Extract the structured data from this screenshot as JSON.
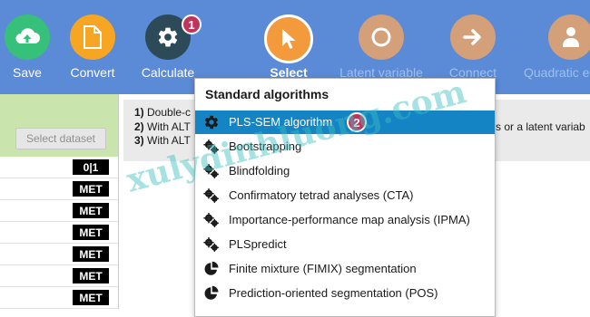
{
  "toolbar": {
    "save": "Save",
    "convert": "Convert",
    "calculate": "Calculate",
    "select": "Select",
    "latent": "Latent variable",
    "connect": "Connect",
    "quadratic": "Quadratic e",
    "badge1": "1"
  },
  "left": {
    "select_dataset": "Select dataset",
    "rows": [
      "0|1",
      "MET",
      "MET",
      "MET",
      "MET",
      "MET",
      "MET",
      ""
    ]
  },
  "info": {
    "line1_num": "1)",
    "line1": "Double-c",
    "line1_right": "",
    "line2_num": "2)",
    "line2": "With ALT",
    "line2_right": "s or a latent variab",
    "line3_num": "3)",
    "line3": "With ALT",
    "line3_right": "."
  },
  "menu": {
    "title": "Standard algorithms",
    "badge2": "2",
    "items": [
      {
        "label": "PLS-SEM algorithm",
        "icon": "gear-icon"
      },
      {
        "label": "Bootstrapping",
        "icon": "gears-icon"
      },
      {
        "label": "Blindfolding",
        "icon": "gears-icon"
      },
      {
        "label": "Confirmatory tetrad analyses (CTA)",
        "icon": "gears-icon"
      },
      {
        "label": "Importance-performance map analysis (IPMA)",
        "icon": "gears-icon"
      },
      {
        "label": "PLSpredict",
        "icon": "gears-icon"
      },
      {
        "label": "Finite mixture (FIMIX) segmentation",
        "icon": "pie-icon"
      },
      {
        "label": "Prediction-oriented segmentation (POS)",
        "icon": "pie-icon"
      }
    ]
  },
  "watermark": "xulydinhluong.com",
  "colors": {
    "toolbar_bg": "#5b8ad6",
    "save": "#37c07a",
    "convert": "#f6a623",
    "calculate": "#2c4a58",
    "select": "#f39a3c",
    "inactive": "#d4a07a",
    "menu_selected": "#1584c5",
    "badge": "#c0345c"
  }
}
